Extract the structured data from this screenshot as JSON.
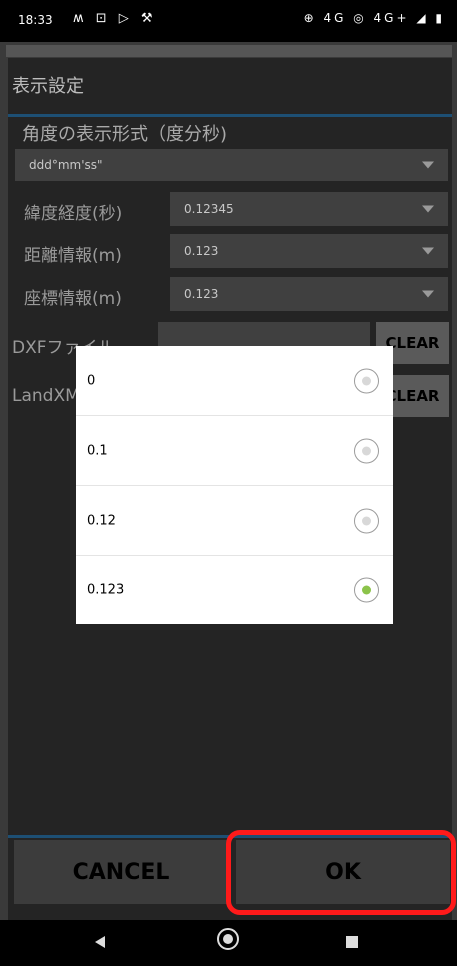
{
  "status_bar": {
    "time": "18:33",
    "left_icons": "ʍ ⊡ ▷ ⚒",
    "right_icons": "⊕ 4G ◎ 4G+ ◢ ▮"
  },
  "panel": {
    "title": "表示設定",
    "angle_heading": "角度の表示形式（度分秒)",
    "angle_format": "ddd°mm'ss\"",
    "lat_lon_label": "緯度経度(秒)",
    "lat_lon_value": "0.12345",
    "distance_label": "距離情報(m)",
    "distance_value": "0.123",
    "coord_label": "座標情報(m)",
    "coord_value": "0.123",
    "dxf_label": "DXFファイル",
    "landxml_label": "LandXML",
    "clear_label": "CLEAR",
    "cancel_label": "CANCEL",
    "ok_label": "OK"
  },
  "popup": {
    "options": [
      "0",
      "0.1",
      "0.12",
      "0.123"
    ],
    "selected_index": 3
  },
  "colors": {
    "accent_line": "#1d4f74",
    "radio_selected": "#8bc34a",
    "highlight": "#ff1a1a"
  }
}
